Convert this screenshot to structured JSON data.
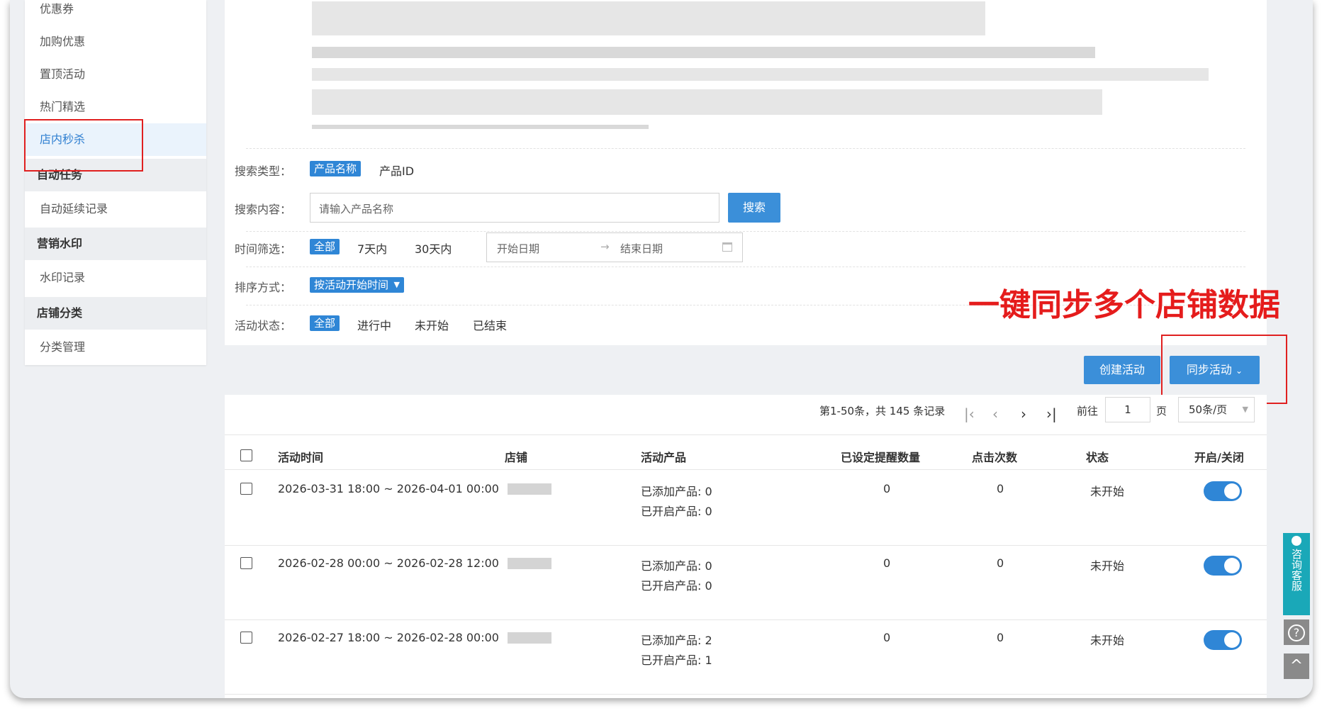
{
  "sidebar": {
    "items_top": [
      "优惠券",
      "加购优惠",
      "置顶活动",
      "热门精选",
      "店内秒杀"
    ],
    "group_auto": "自动任务",
    "item_auto": "自动延续记录",
    "group_watermark": "营销水印",
    "item_watermark": "水印记录",
    "group_category": "店铺分类",
    "item_category": "分类管理"
  },
  "filters": {
    "search_type_label": "搜索类型：",
    "search_type_options": [
      "产品名称",
      "产品ID"
    ],
    "search_content_label": "搜索内容：",
    "search_placeholder": "请输入产品名称",
    "search_button": "搜索",
    "time_label": "时间筛选：",
    "time_options": [
      "全部",
      "7天内",
      "30天内"
    ],
    "start_date_placeholder": "开始日期",
    "end_date_placeholder": "结束日期",
    "sort_label": "排序方式：",
    "sort_value": "按活动开始时间",
    "status_label": "活动状态：",
    "status_options": [
      "全部",
      "进行中",
      "未开始",
      "已结束"
    ]
  },
  "annotation": "一键同步多个店铺数据",
  "actions": {
    "create": "创建活动",
    "sync": "同步活动"
  },
  "pagination": {
    "summary": "第1-50条，共 145 条记录",
    "goto_label": "前往",
    "page_value": "1",
    "page_unit": "页",
    "page_size": "50条/页"
  },
  "table": {
    "headers": [
      "活动时间",
      "店铺",
      "活动产品",
      "已设定提醒数量",
      "点击次数",
      "状态",
      "开启/关闭"
    ],
    "rows": [
      {
        "time": "2026-03-31 18:00 ~ 2026-04-01 00:00",
        "added": "已添加产品: 0",
        "enabled": "已开启产品: 0",
        "reminders": "0",
        "clicks": "0",
        "status": "未开始"
      },
      {
        "time": "2026-02-28 00:00 ~ 2026-02-28 12:00",
        "added": "已添加产品: 0",
        "enabled": "已开启产品: 0",
        "reminders": "0",
        "clicks": "0",
        "status": "未开始"
      },
      {
        "time": "2026-02-27 18:00 ~ 2026-02-28 00:00",
        "added": "已添加产品: 2",
        "enabled": "已开启产品: 1",
        "reminders": "0",
        "clicks": "0",
        "status": "未开始"
      }
    ]
  },
  "floating": {
    "customer_service": "咨询客服",
    "help_icon": "?",
    "top_icon": "^"
  },
  "colors": {
    "primary": "#2f86d6",
    "annotation_red": "#e51c1c",
    "service_teal": "#1aa8b8"
  }
}
